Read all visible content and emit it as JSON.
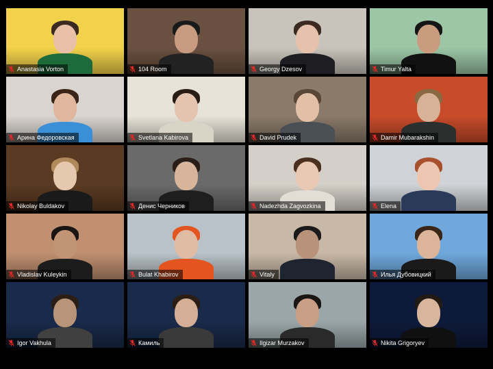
{
  "meeting": {
    "accent_speaking": "#f5e000",
    "mic_muted_color": "#e02828",
    "participants": [
      {
        "name": "Anastasia Vorton",
        "muted": true,
        "speaking": true,
        "bg": "#f2d24a",
        "skin": "#e8c0a8",
        "hair": "#3a2a22",
        "shirt": "#1d6b3a"
      },
      {
        "name": "104 Room",
        "muted": true,
        "speaking": false,
        "bg": "#6a5040",
        "skin": "#c89a80",
        "hair": "#1a1a1a",
        "shirt": "#222"
      },
      {
        "name": "Georgy Dzesov",
        "muted": true,
        "speaking": false,
        "bg": "#c9c4bb",
        "skin": "#e6c2ac",
        "hair": "#3b2a20",
        "shirt": "#1e1e22"
      },
      {
        "name": "Timur Yalta",
        "muted": true,
        "speaking": false,
        "bg": "#9cc6a6",
        "skin": "#c99c80",
        "hair": "#151515",
        "shirt": "#111"
      },
      {
        "name": "Арина Федоровская",
        "muted": true,
        "speaking": false,
        "bg": "#d9d4cf",
        "skin": "#e0b69c",
        "hair": "#3a2418",
        "shirt": "#3b8fd6"
      },
      {
        "name": "Svetlana Kabirova",
        "muted": true,
        "speaking": false,
        "bg": "#e7e3d8",
        "skin": "#e4c4ae",
        "hair": "#2a1d16",
        "shirt": "#d9d4c6"
      },
      {
        "name": "David Prudek",
        "muted": true,
        "speaking": false,
        "bg": "#8a7a6a",
        "skin": "#e2c0a8",
        "hair": "#5a4634",
        "shirt": "#4a4f55"
      },
      {
        "name": "Damir Mubarakshin",
        "muted": true,
        "speaking": false,
        "bg": "#c84b2a",
        "skin": "#d8b296",
        "hair": "#8a6a44",
        "shirt": "#2b2f2e"
      },
      {
        "name": "Nikolay Buldakov",
        "muted": true,
        "speaking": false,
        "bg": "#5a3a22",
        "skin": "#e6c8ae",
        "hair": "#b08a5a",
        "shirt": "#1a1a1a"
      },
      {
        "name": "Денис Черников",
        "muted": true,
        "speaking": false,
        "bg": "#6a6a6a",
        "skin": "#d7b49c",
        "hair": "#2a1f18",
        "shirt": "#1e1e1e"
      },
      {
        "name": "Nadezhda Zagvozkina",
        "muted": true,
        "speaking": false,
        "bg": "#d4cfc8",
        "skin": "#e8c8b2",
        "hair": "#4a2e1e",
        "shirt": "#e2ddd5"
      },
      {
        "name": "Elena",
        "muted": true,
        "speaking": false,
        "bg": "#cfd2d6",
        "skin": "#ecc6b0",
        "hair": "#a8502e",
        "shirt": "#2c3a5a"
      },
      {
        "name": "Vladislav Kuleykin",
        "muted": true,
        "speaking": false,
        "bg": "#c09070",
        "skin": "#c09474",
        "hair": "#1a1412",
        "shirt": "#1c1c1c"
      },
      {
        "name": "Bulat Khabirov",
        "muted": true,
        "speaking": false,
        "bg": "#b9c2c8",
        "skin": "#e0bca4",
        "hair": "#e4541e",
        "shirt": "#e4541e"
      },
      {
        "name": "Vitaly",
        "muted": true,
        "speaking": false,
        "bg": "#c8b8a6",
        "skin": "#b8927a",
        "hair": "#1a1a1a",
        "shirt": "#1e2430"
      },
      {
        "name": "Илья Дубовицкий",
        "muted": true,
        "speaking": false,
        "bg": "#6fa8dc",
        "skin": "#dcb49a",
        "hair": "#3a2616",
        "shirt": "#1a1a1a"
      },
      {
        "name": "Igor Vakhula",
        "muted": true,
        "speaking": false,
        "bg": "#1a2a4a",
        "skin": "#b89478",
        "hair": "#2a1e16",
        "shirt": "#404040"
      },
      {
        "name": "Камиль",
        "muted": true,
        "speaking": false,
        "bg": "#1a2a4a",
        "skin": "#d4ae96",
        "hair": "#2a1e16",
        "shirt": "#3a3a3a"
      },
      {
        "name": "Ilgizar Murzakov",
        "muted": true,
        "speaking": false,
        "bg": "#9aa6a8",
        "skin": "#c89e84",
        "hair": "#1a1614",
        "shirt": "#2a2a2a"
      },
      {
        "name": "Nikita Grigoryev",
        "muted": true,
        "speaking": false,
        "bg": "#0e1a3a",
        "skin": "#d8b69e",
        "hair": "#221a14",
        "shirt": "#101010"
      }
    ]
  }
}
